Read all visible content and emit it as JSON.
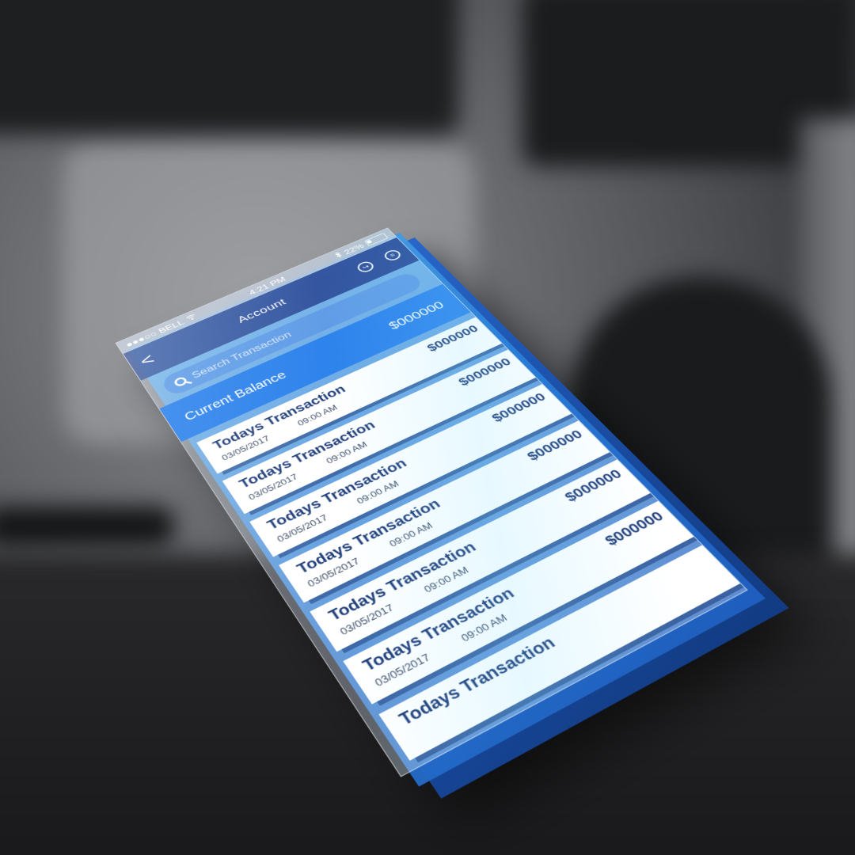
{
  "status_bar": {
    "carrier": "●●●○○ BELL",
    "wifi_icon": "wifi-icon",
    "time": "4:21 PM",
    "bluetooth_icon": "bluetooth-icon",
    "battery": "22%"
  },
  "nav": {
    "back_symbol": "<",
    "title": "Account",
    "logout_symbol": "↪",
    "menu_symbol": "≡"
  },
  "search": {
    "placeholder": "Search Transaction"
  },
  "balance": {
    "label": "Current Balance",
    "value": "$000000"
  },
  "transactions": [
    {
      "title": "Todays Transaction",
      "date": "03/05/2017",
      "time": "09:00 AM",
      "amount": "$000000"
    },
    {
      "title": "Todays Transaction",
      "date": "03/05/2017",
      "time": "09:00 AM",
      "amount": "$000000"
    },
    {
      "title": "Todays Transaction",
      "date": "03/05/2017",
      "time": "09:00 AM",
      "amount": "$000000"
    },
    {
      "title": "Todays Transaction",
      "date": "03/05/2017",
      "time": "09:00 AM",
      "amount": "$000000"
    },
    {
      "title": "Todays Transaction",
      "date": "03/05/2017",
      "time": "09:00 AM",
      "amount": "$000000"
    },
    {
      "title": "Todays Transaction",
      "date": "03/05/2017",
      "time": "09:00 AM",
      "amount": "$000000"
    },
    {
      "title": "Todays Transaction",
      "date": "",
      "time": "",
      "amount": ""
    }
  ],
  "colors": {
    "accent": "#2e83ec",
    "nav": "#2a4a96",
    "text_dark": "#1d3b78"
  }
}
